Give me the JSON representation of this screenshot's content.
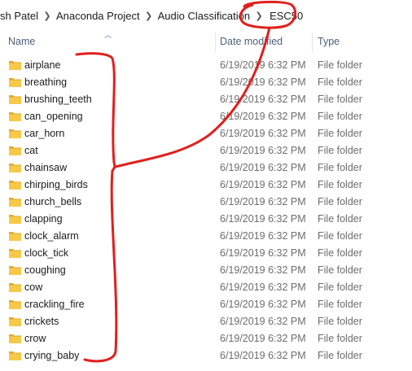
{
  "breadcrumb": {
    "items": [
      "sh Patel",
      "Anaconda Project",
      "Audio Classification",
      "ESC50"
    ],
    "separator": "›"
  },
  "columns": {
    "name": "Name",
    "date_modified": "Date modified",
    "type": "Type"
  },
  "rows": [
    {
      "name": "airplane",
      "date": "6/19/2019 6:32 PM",
      "type": "File folder"
    },
    {
      "name": "breathing",
      "date": "6/19/2019 6:32 PM",
      "type": "File folder"
    },
    {
      "name": "brushing_teeth",
      "date": "6/19/2019 6:32 PM",
      "type": "File folder"
    },
    {
      "name": "can_opening",
      "date": "6/19/2019 6:32 PM",
      "type": "File folder"
    },
    {
      "name": "car_horn",
      "date": "6/19/2019 6:32 PM",
      "type": "File folder"
    },
    {
      "name": "cat",
      "date": "6/19/2019 6:32 PM",
      "type": "File folder"
    },
    {
      "name": "chainsaw",
      "date": "6/19/2019 6:32 PM",
      "type": "File folder"
    },
    {
      "name": "chirping_birds",
      "date": "6/19/2019 6:32 PM",
      "type": "File folder"
    },
    {
      "name": "church_bells",
      "date": "6/19/2019 6:32 PM",
      "type": "File folder"
    },
    {
      "name": "clapping",
      "date": "6/19/2019 6:32 PM",
      "type": "File folder"
    },
    {
      "name": "clock_alarm",
      "date": "6/19/2019 6:32 PM",
      "type": "File folder"
    },
    {
      "name": "clock_tick",
      "date": "6/19/2019 6:32 PM",
      "type": "File folder"
    },
    {
      "name": "coughing",
      "date": "6/19/2019 6:32 PM",
      "type": "File folder"
    },
    {
      "name": "cow",
      "date": "6/19/2019 6:32 PM",
      "type": "File folder"
    },
    {
      "name": "crackling_fire",
      "date": "6/19/2019 6:32 PM",
      "type": "File folder"
    },
    {
      "name": "crickets",
      "date": "6/19/2019 6:32 PM",
      "type": "File folder"
    },
    {
      "name": "crow",
      "date": "6/19/2019 6:32 PM",
      "type": "File folder"
    },
    {
      "name": "crying_baby",
      "date": "6/19/2019 6:32 PM",
      "type": "File folder"
    }
  ],
  "colors": {
    "folder": "#f7c948",
    "folder_dark": "#e0a82e",
    "annotation": "#e0201e",
    "header_text": "#4c607a"
  },
  "icons": {
    "folder": "folder-icon",
    "separator": "chevron-right-icon",
    "sort": "sort-up-arrow-icon"
  }
}
